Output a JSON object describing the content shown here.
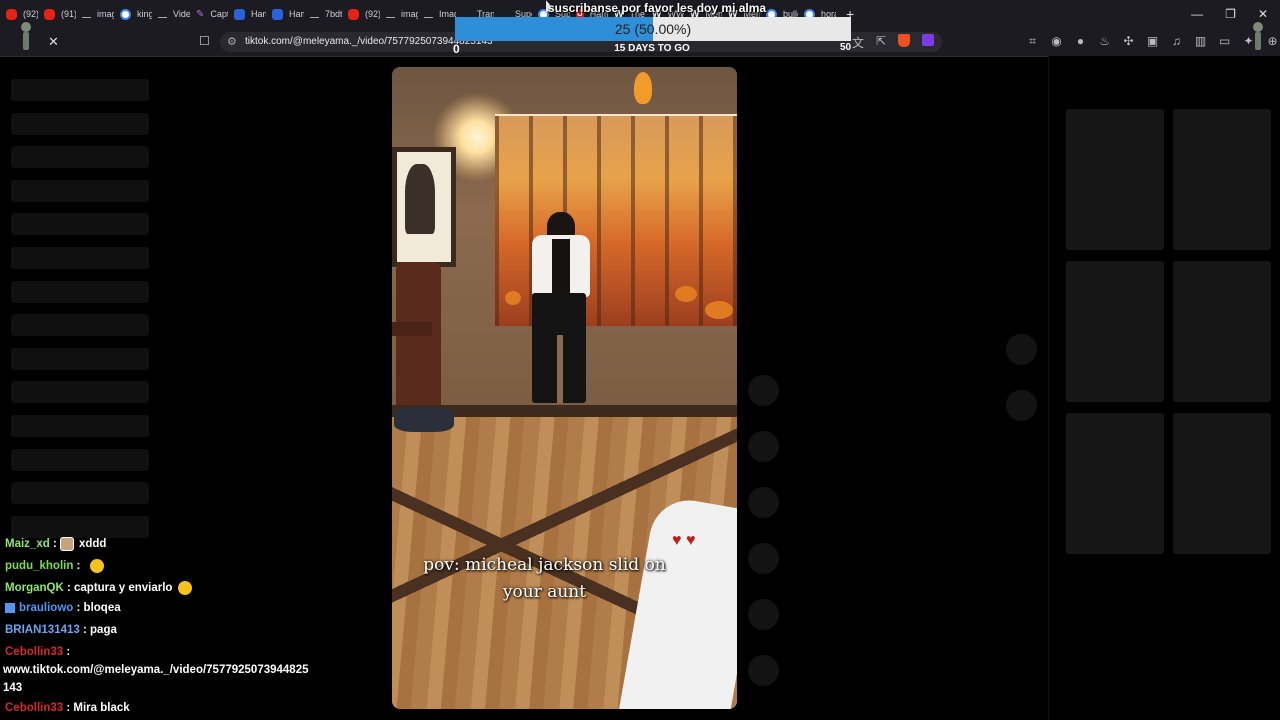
{
  "tabs": [
    {
      "label": "(92)",
      "icon": "youtube-icon"
    },
    {
      "label": "(91)",
      "icon": "youtube-icon"
    },
    {
      "label": "imag",
      "icon": "line-icon"
    },
    {
      "label": "king",
      "icon": "google-icon"
    },
    {
      "label": "Vide",
      "icon": "line-icon"
    },
    {
      "label": "Capt",
      "icon": "pen-icon"
    },
    {
      "label": "Ham",
      "icon": "blue-icon"
    },
    {
      "label": "Ham",
      "icon": "blue-icon"
    },
    {
      "label": "7bdt",
      "icon": "line-icon"
    },
    {
      "label": "(92)",
      "icon": "youtube-icon"
    },
    {
      "label": "imag",
      "icon": "line-icon"
    },
    {
      "label": "Imag",
      "icon": "line-icon"
    },
    {
      "label": "Tran",
      "icon": "line-icon"
    },
    {
      "label": "Supe",
      "icon": "line-icon"
    },
    {
      "label": "Sup",
      "icon": "google-icon"
    },
    {
      "label": "Ham",
      "icon": "u-icon"
    },
    {
      "label": "The",
      "icon": "w-icon"
    },
    {
      "label": "WW",
      "icon": "w-icon"
    },
    {
      "label": "Men",
      "icon": "w-icon"
    },
    {
      "label": "Men",
      "icon": "w-icon"
    },
    {
      "label": "bulle",
      "icon": "google-icon"
    },
    {
      "label": "hora",
      "icon": "google-icon"
    }
  ],
  "browser": {
    "url": "tiktok.com/@meleyama._/video/7577925073944825143",
    "close_glyph": "✕",
    "new_tab_glyph": "+",
    "minimize_glyph": "—",
    "restore_glyph": "❐",
    "window_close_glyph": "✕"
  },
  "overlay": {
    "title": "suscribanse por favor les doy mi alma",
    "goal_text": "25 (50.00%)",
    "goal_fraction": 0.5,
    "goal_min": "0",
    "goal_max": "50",
    "goal_sub": "15 DAYS TO GO",
    "accent": "#2e8fd8"
  },
  "video": {
    "caption_line1": "pov: micheal jackson slid on",
    "caption_line2": "your aunt"
  },
  "chat": [
    {
      "user": "Maiz_xd",
      "user_color": "#8ee86a",
      "message": "xddd",
      "emote": "face"
    },
    {
      "user": "pudu_kholin",
      "user_color": "#7fdc4e",
      "message": "",
      "emote": "yellow"
    },
    {
      "user": "MorganQK",
      "user_color": "#8ee86a",
      "message": "captura y enviarlo",
      "emote": "yellow"
    },
    {
      "user": "brauliowo",
      "user_color": "#4f97f3",
      "message": "bloqea",
      "emote": ""
    },
    {
      "user": "BRIAN131413",
      "user_color": "#6aa5f0",
      "message": "paga",
      "emote": ""
    },
    {
      "user": "Cebollin33",
      "user_color": "#d42a2a",
      "message": "",
      "emote": ""
    },
    {
      "line": "www.tiktok.com/@meleyama._/video/7577925073944825"
    },
    {
      "line": "143"
    },
    {
      "user": "Cebollin33",
      "user_color": "#d42a2a",
      "message": "Mira black",
      "emote": ""
    }
  ],
  "chat_sep": " : "
}
